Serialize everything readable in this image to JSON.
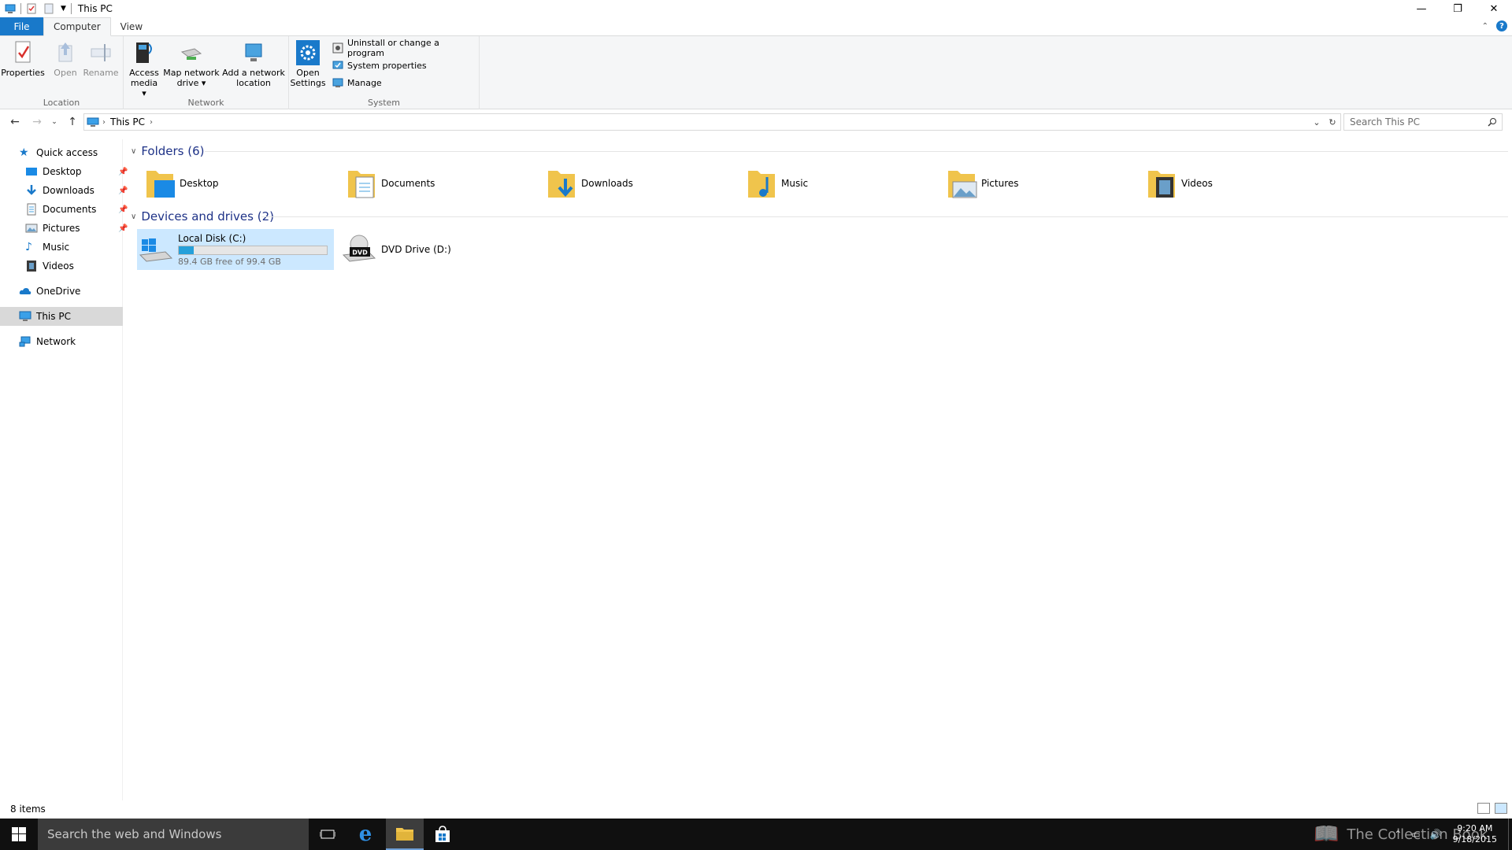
{
  "window": {
    "title": "This PC"
  },
  "ribbon_tabs": [
    {
      "label": "File"
    },
    {
      "label": "Computer"
    },
    {
      "label": "View"
    }
  ],
  "ribbon": {
    "location": {
      "group_label": "Location",
      "properties": "Properties",
      "open": "Open",
      "rename": "Rename"
    },
    "network": {
      "group_label": "Network",
      "access_media_1": "Access",
      "access_media_2": "media",
      "map_drive_1": "Map network",
      "map_drive_2": "drive",
      "add_location_1": "Add a network",
      "add_location_2": "location"
    },
    "system": {
      "group_label": "System",
      "open_settings_1": "Open",
      "open_settings_2": "Settings",
      "uninstall": "Uninstall or change a program",
      "system_properties": "System properties",
      "manage": "Manage"
    }
  },
  "address": {
    "crumb": "This PC",
    "search_placeholder": "Search This PC"
  },
  "nav_pane": {
    "quick_access": "Quick access",
    "quick_items": [
      {
        "label": "Desktop",
        "pinned": true
      },
      {
        "label": "Downloads",
        "pinned": true
      },
      {
        "label": "Documents",
        "pinned": true
      },
      {
        "label": "Pictures",
        "pinned": true
      },
      {
        "label": "Music",
        "pinned": false
      },
      {
        "label": "Videos",
        "pinned": false
      }
    ],
    "onedrive": "OneDrive",
    "this_pc": "This PC",
    "network": "Network"
  },
  "content": {
    "folders_header": "Folders (6)",
    "folders": [
      {
        "label": "Desktop"
      },
      {
        "label": "Documents"
      },
      {
        "label": "Downloads"
      },
      {
        "label": "Music"
      },
      {
        "label": "Pictures"
      },
      {
        "label": "Videos"
      }
    ],
    "devices_header": "Devices and drives (2)",
    "drives": [
      {
        "label": "Local Disk (C:)",
        "free": "89.4 GB free of 99.4 GB",
        "used_fraction": 0.1
      },
      {
        "label": "DVD Drive (D:)"
      }
    ]
  },
  "status": {
    "items": "8 items"
  },
  "taskbar": {
    "search": "Search the web and Windows",
    "time": "9:20 AM",
    "date": "9/18/2015",
    "watermark": "The Collection Book"
  },
  "colors": {
    "accent": "#1979ca",
    "selection": "#cce8ff",
    "folder": "#f0c44c",
    "drive_bar": "#26a0da"
  }
}
